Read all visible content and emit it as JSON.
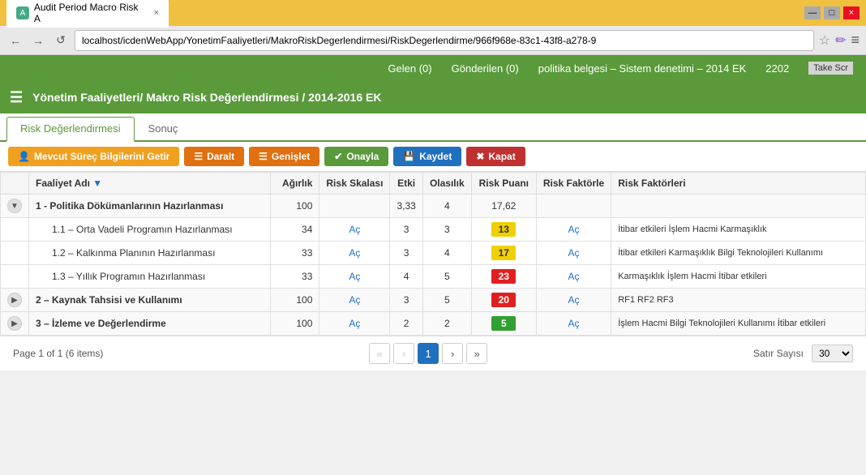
{
  "titleBar": {
    "tabTitle": "Audit Period Macro Risk A",
    "favicon": "A",
    "closeLabel": "×",
    "minimizeLabel": "—",
    "maximizeLabel": "□"
  },
  "addressBar": {
    "url": "localhost/icdenWebApp/YonetimFaaliyetleri/MakroRiskDegerlendirmesi/RiskDegerlendirme/966f968e-83c1-43f8-a278-9",
    "backLabel": "←",
    "forwardLabel": "→",
    "reloadLabel": "↺",
    "starLabel": "☆",
    "menuLabel": "≡",
    "penLabel": "✏"
  },
  "notifBar": {
    "gelen": "Gelen (0)",
    "gonderilen": "Gönderilen (0)",
    "politika": "politika belgesi – Sistem denetimi – 2014 EK",
    "counter": "2202",
    "takeScr": "Take Scr"
  },
  "appHeader": {
    "breadcrumb": "Yönetim Faaliyetleri/ Makro Risk Değerlendirmesi / 2014-2016 EK",
    "hamburger": "☰"
  },
  "tabs": [
    {
      "label": "Risk Değerlendirmesi",
      "active": true
    },
    {
      "label": "Sonuç",
      "active": false
    }
  ],
  "toolbar": {
    "mevcutBtn": "Mevcut Süreç Bilgilerini Getir",
    "daraltBtn": "Daralt",
    "genisletBtn": "Genişlet",
    "onaylaBtn": "Onayla",
    "kaydetBtn": "Kaydet",
    "kapatBtn": "Kapat"
  },
  "table": {
    "headers": [
      "",
      "Faaliyet Adı",
      "Ağırlık",
      "Risk Skalası",
      "Etki",
      "Olasılık",
      "Risk Puanı",
      "Risk Faktörle",
      "Risk Faktörleri"
    ],
    "rows": [
      {
        "type": "group",
        "expand": true,
        "name": "1 - Politika Dökümanlarının Hazırlanması",
        "agirlik": "100",
        "riskSkalasi": "",
        "etki": "3,33",
        "olasilik": "4",
        "riskPuani": "17,62",
        "riskPuaniColor": "",
        "riskFaktorle": "",
        "riskFaktorleri": ""
      },
      {
        "type": "child",
        "expand": false,
        "name": "1.1 – Orta Vadeli Programın Hazırlanması",
        "agirlik": "34",
        "riskSkalasi": "Aç",
        "etki": "3",
        "olasilik": "3",
        "riskPuani": "13",
        "riskPuaniColor": "yellow",
        "riskFaktorle": "Aç",
        "riskFaktorleri": "İtibar etkileri İşlem Hacmi Karmaşıklık"
      },
      {
        "type": "child",
        "expand": false,
        "name": "1.2 – Kalkınma Planının Hazırlanması",
        "agirlik": "33",
        "riskSkalasi": "Aç",
        "etki": "3",
        "olasilik": "4",
        "riskPuani": "17",
        "riskPuaniColor": "yellow",
        "riskFaktorle": "Aç",
        "riskFaktorleri": "İtibar etkileri Karmaşıklık Bilgi Teknolojileri Kullanımı"
      },
      {
        "type": "child",
        "expand": false,
        "name": "1.3 – Yıllık Programın Hazırlanması",
        "agirlik": "33",
        "riskSkalasi": "Aç",
        "etki": "4",
        "olasilik": "5",
        "riskPuani": "23",
        "riskPuaniColor": "red",
        "riskFaktorle": "Aç",
        "riskFaktorleri": "Karmaşıklık İşlem Hacmi İtibar etkileri"
      },
      {
        "type": "group",
        "expand": false,
        "name": "2 – Kaynak Tahsisi ve Kullanımı",
        "agirlik": "100",
        "riskSkalasi": "Aç",
        "etki": "3",
        "olasilik": "5",
        "riskPuani": "20",
        "riskPuaniColor": "red",
        "riskFaktorle": "Aç",
        "riskFaktorleri": "RF1 RF2 RF3"
      },
      {
        "type": "group",
        "expand": false,
        "name": "3 – İzleme ve Değerlendirme",
        "agirlik": "100",
        "riskSkalasi": "Aç",
        "etki": "2",
        "olasilik": "2",
        "riskPuani": "5",
        "riskPuaniColor": "green",
        "riskFaktorle": "Aç",
        "riskFaktorleri": "İşlem Hacmi Bilgi Teknolojileri Kullanımı İtibar etkileri"
      }
    ]
  },
  "pagination": {
    "pageInfo": "Page 1 of 1 (6 items)",
    "currentPage": "1",
    "satirSayisi": "Satır Sayısı",
    "satirValue": "30",
    "prevPrev": "«",
    "prev": "‹",
    "next": "›",
    "nextNext": "»"
  }
}
